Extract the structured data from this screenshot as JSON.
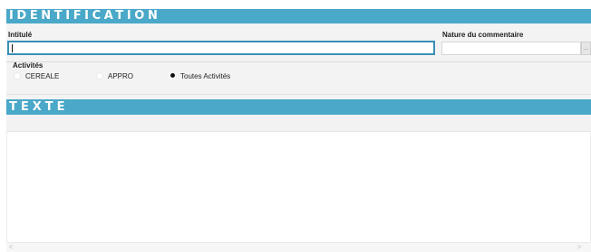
{
  "sections": {
    "identification_title": "IDENTIFICATION",
    "texte_title": "TEXTE"
  },
  "fields": {
    "intitule": {
      "label": "Intitulé",
      "value": ""
    },
    "nature": {
      "label": "Nature du commentaire",
      "value": "",
      "button_label": "..."
    }
  },
  "activites": {
    "label": "Activités",
    "options": [
      {
        "label": "CEREALE",
        "selected": false
      },
      {
        "label": "APPRO",
        "selected": false
      },
      {
        "label": "Toutes Activités",
        "selected": true
      }
    ]
  },
  "texte": {
    "value": ""
  },
  "scrollbar": {
    "left_arrow": "<",
    "right_arrow": ">"
  },
  "colors": {
    "header_bg": "#4aa8c8",
    "focus_border": "#3a8fb7",
    "panel_bg": "#f3f3f3"
  }
}
